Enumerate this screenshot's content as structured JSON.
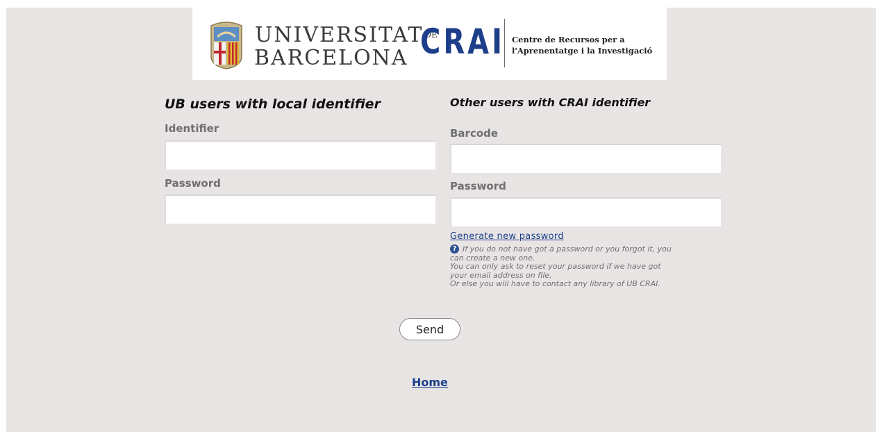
{
  "banner": {
    "university_line1": "UNIVERSITAT",
    "university_de": "DE",
    "university_line2": "BARCELONA",
    "crai": "CRAI",
    "crai_subtitle_line1": "Centre de Recursos per a",
    "crai_subtitle_line2": "l'Aprenentatge i la Investigació"
  },
  "left_form": {
    "heading": "UB users with local identifier",
    "identifier_label": "Identifier",
    "identifier_value": "",
    "password_label": "Password",
    "password_value": ""
  },
  "right_form": {
    "heading": "Other users with CRAI identifier",
    "barcode_label": "Barcode",
    "barcode_value": "",
    "password_label": "Password",
    "password_value": "",
    "generate_link": "Generate new password",
    "help_icon": "question-icon",
    "help_line1": "If you do not have got a password or you forgot it, you",
    "help_line2": "can create a new one.",
    "help_line3": "You can only ask to reset your password if we have got",
    "help_line4": "your email address on file.",
    "help_line5": "Or else you will have to contact any library of UB CRAI."
  },
  "actions": {
    "send_label": "Send",
    "home_link": "Home"
  },
  "colors": {
    "background": "#e8e4e4",
    "link": "#1b3f8b",
    "crai_blue": "#1d3f8a"
  }
}
